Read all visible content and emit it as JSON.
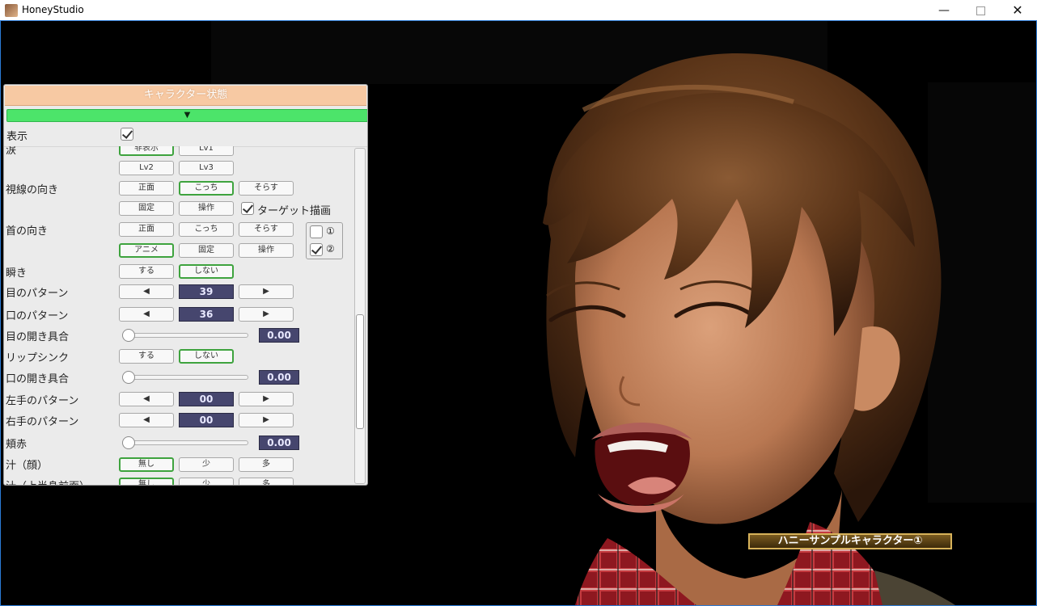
{
  "window": {
    "title": "HoneyStudio",
    "minimize_icon": "minimize-icon",
    "maximize_icon": "maximize-icon",
    "close_icon": "close-icon"
  },
  "panel": {
    "header": "キャラクター状態",
    "collapse_arrow": "▼",
    "show_label": "表示",
    "show_checked": true,
    "rows": {
      "tears": {
        "label": "涙",
        "buttons": [
          "非表示",
          "Lv1",
          "Lv2",
          "Lv3"
        ],
        "selected": "非表示"
      },
      "gaze": {
        "label": "視線の向き",
        "buttons": [
          "正面",
          "こっち",
          "そらす",
          "固定",
          "操作"
        ],
        "selected": "こっち",
        "target_label": "ターゲット描画",
        "target_checked": true
      },
      "neck": {
        "label": "首の向き",
        "buttons": [
          "正面",
          "こっち",
          "そらす",
          "アニメ",
          "固定",
          "操作"
        ],
        "selected": "アニメ",
        "opt1": "①",
        "opt2": "②",
        "opt1_checked": false,
        "opt2_checked": true
      },
      "blink": {
        "label": "瞬き",
        "buttons": [
          "する",
          "しない"
        ],
        "selected": "しない"
      },
      "eye_pattern": {
        "label": "目のパターン",
        "value": "39"
      },
      "mouth_pattern": {
        "label": "口のパターン",
        "value": "36"
      },
      "eye_open": {
        "label": "目の開き具合",
        "value": "0.00"
      },
      "lipsync": {
        "label": "リップシンク",
        "buttons": [
          "する",
          "しない"
        ],
        "selected": "しない"
      },
      "mouth_open": {
        "label": "口の開き具合",
        "value": "0.00"
      },
      "left_hand": {
        "label": "左手のパターン",
        "value": "00"
      },
      "right_hand": {
        "label": "右手のパターン",
        "value": "00"
      },
      "cheek": {
        "label": "頬赤",
        "value": "0.00"
      },
      "sweat_face": {
        "label": "汁（顔）",
        "buttons": [
          "無し",
          "少",
          "多"
        ],
        "selected": "無し"
      },
      "sweat_upper": {
        "label": "汁（上半身前面）",
        "buttons": [
          "無し",
          "少",
          "多"
        ],
        "selected": "無し"
      }
    },
    "arrow_left": "◀",
    "arrow_right": "▶"
  },
  "character": {
    "name_tag": "ハニーサンプルキャラクター①",
    "hair_color": "#5a3418",
    "skin_color": "#c98a62",
    "shirt_color": "#b5202a"
  },
  "colors": {
    "header_bg": "#f7c9a3",
    "collapse_bar": "#4ce46a",
    "selected_border": "#3ea33e",
    "value_bg": "#46466e"
  }
}
